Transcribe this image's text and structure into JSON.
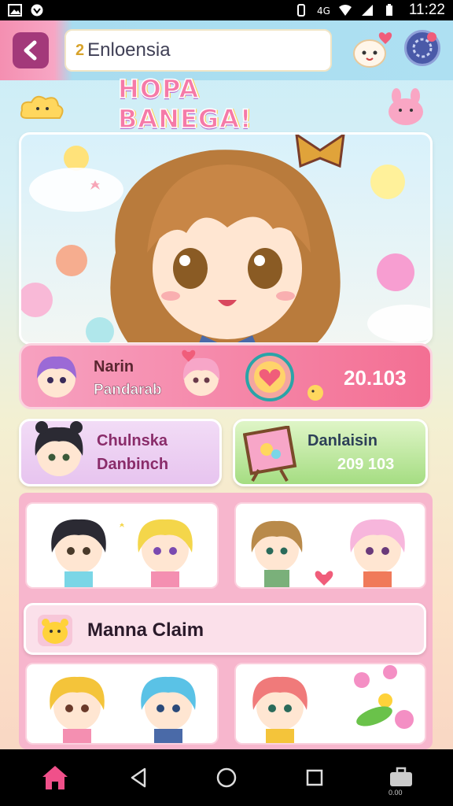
{
  "statusbar": {
    "time": "11:22"
  },
  "header": {
    "search_value": "Enloensia",
    "search_prefix": "2"
  },
  "title": "HOPA BANEGA!",
  "featured": {
    "name": "Narin",
    "subtitle": "Pandarab",
    "value": "20.103"
  },
  "cards": {
    "left": {
      "line1": "Chulnska",
      "line2": "Danbinch"
    },
    "right": {
      "line1": "Danlaisin",
      "line2": "209 103"
    }
  },
  "claim": {
    "label": "Manna Claim"
  },
  "nav": {
    "items": [
      "home-icon",
      "back-triangle-icon",
      "circle-home-icon",
      "square-recents-icon",
      "briefcase-icon"
    ],
    "last_label": "0.00"
  },
  "colors": {
    "accent_pink": "#f36f93",
    "back_button": "#a3397a",
    "green_card": "#a5dd82",
    "lilac_card": "#e7c4ef"
  }
}
